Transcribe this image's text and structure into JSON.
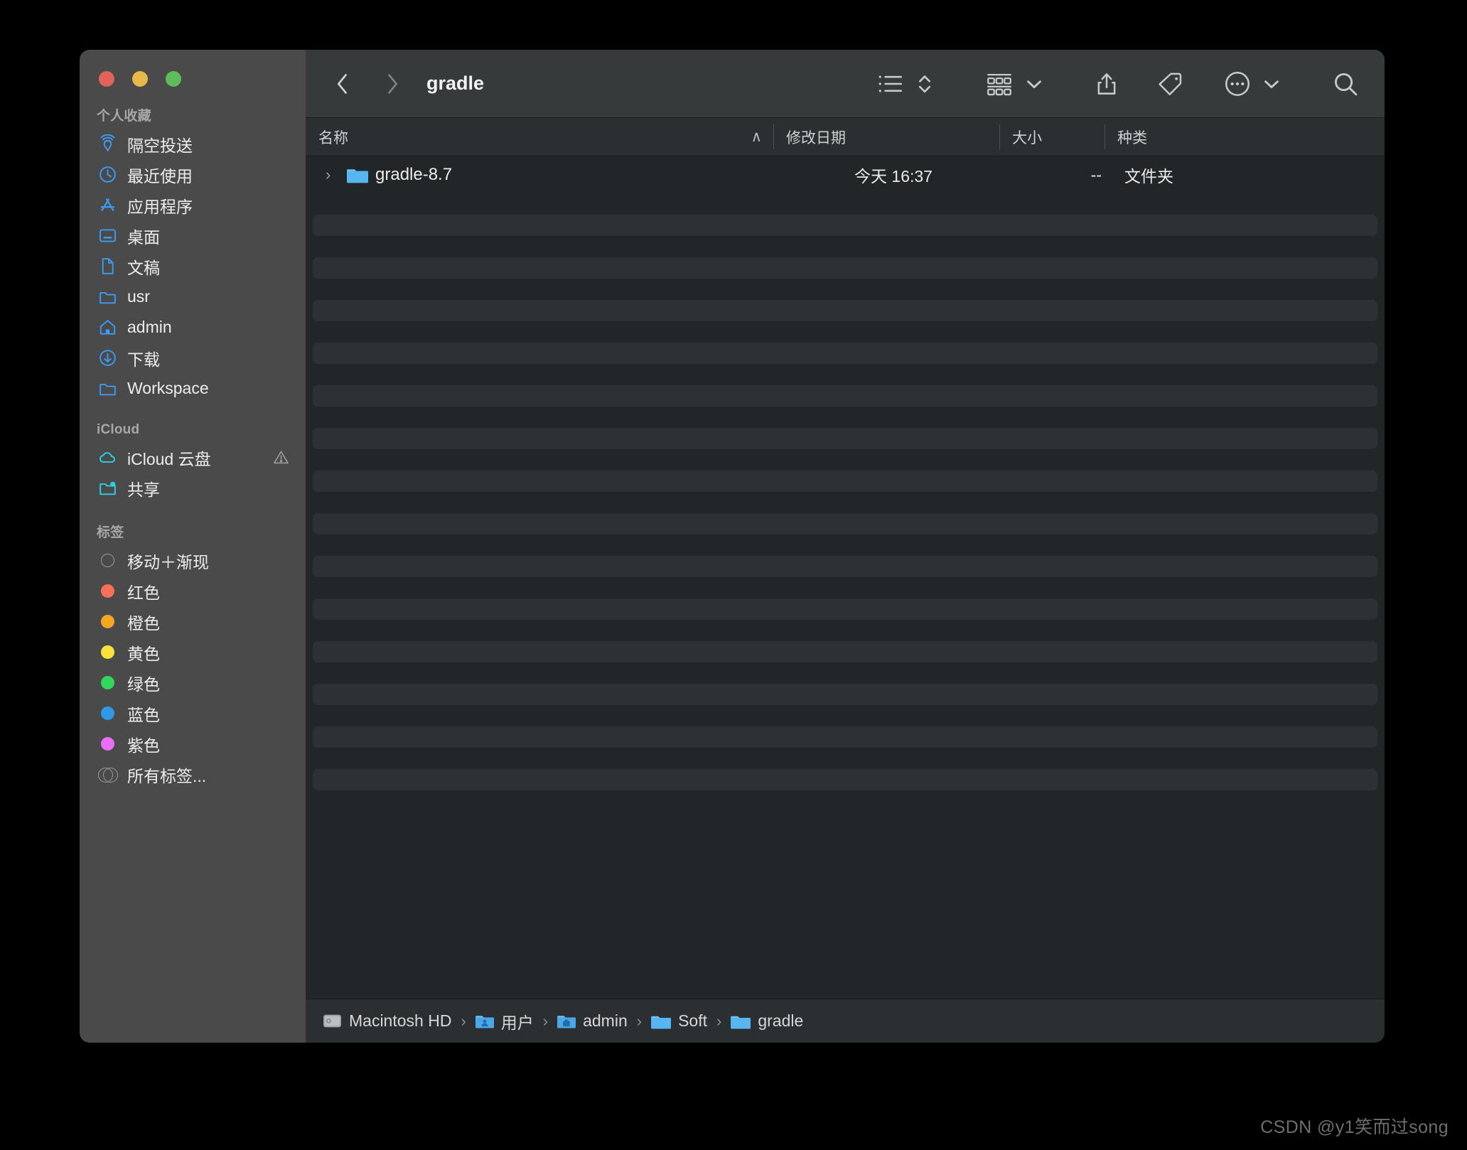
{
  "window": {
    "title": "gradle",
    "traffic_lights": [
      "close",
      "minimize",
      "maximize"
    ],
    "colors": {
      "close": "#e1645b",
      "minimize": "#e8b84b",
      "maximize": "#5ebd5a",
      "sidebar_bg": "#4a4a4a",
      "toolbar_bg": "#363a3b",
      "content_bg": "#222628",
      "stripe": "#2d3134",
      "accent_blue": "#3c9bf5",
      "accent_cyan": "#2ccfe6"
    }
  },
  "toolbar": {
    "back_label": "‹",
    "forward_label": "›",
    "buttons": [
      {
        "name": "view-list",
        "label": ""
      },
      {
        "name": "sort-stepper",
        "label": ""
      },
      {
        "name": "group-by",
        "label": ""
      },
      {
        "name": "group-by-chevron",
        "label": ""
      },
      {
        "name": "share",
        "label": ""
      },
      {
        "name": "tag",
        "label": ""
      },
      {
        "name": "more",
        "label": ""
      },
      {
        "name": "more-chevron",
        "label": ""
      },
      {
        "name": "search",
        "label": ""
      }
    ]
  },
  "sidebar": {
    "sections": [
      {
        "header": "个人收藏",
        "items": [
          {
            "label": "隔空投送",
            "icon": "airdrop-icon"
          },
          {
            "label": "最近使用",
            "icon": "recents-clock-icon"
          },
          {
            "label": "应用程序",
            "icon": "applications-icon"
          },
          {
            "label": "桌面",
            "icon": "desktop-icon"
          },
          {
            "label": "文稿",
            "icon": "documents-icon"
          },
          {
            "label": "usr",
            "icon": "folder-icon"
          },
          {
            "label": "admin",
            "icon": "home-icon"
          },
          {
            "label": "下载",
            "icon": "downloads-icon"
          },
          {
            "label": "Workspace",
            "icon": "folder-icon"
          }
        ]
      },
      {
        "header": "iCloud",
        "items": [
          {
            "label": "iCloud 云盘",
            "icon": "icloud-icon",
            "trailing_icon": "warning-icon"
          },
          {
            "label": "共享",
            "icon": "shared-folder-icon"
          }
        ]
      },
      {
        "header": "标签",
        "items": [
          {
            "label": "移动＋渐现",
            "icon": "tag-dot-outline",
            "color": "transparent"
          },
          {
            "label": "红色",
            "icon": "tag-dot",
            "color": "#fa6e5a"
          },
          {
            "label": "橙色",
            "icon": "tag-dot",
            "color": "#f5a623"
          },
          {
            "label": "黄色",
            "icon": "tag-dot",
            "color": "#fce23d"
          },
          {
            "label": "绿色",
            "icon": "tag-dot",
            "color": "#30d85c"
          },
          {
            "label": "蓝色",
            "icon": "tag-dot",
            "color": "#2f9ae8"
          },
          {
            "label": "紫色",
            "icon": "tag-dot",
            "color": "#ea6df5"
          },
          {
            "label": "所有标签...",
            "icon": "all-tags-icon",
            "color": "transparent"
          }
        ]
      }
    ]
  },
  "file_list": {
    "columns": [
      {
        "key": "name",
        "label": "名称",
        "sort_indicator": "∧"
      },
      {
        "key": "date",
        "label": "修改日期"
      },
      {
        "key": "size",
        "label": "大小"
      },
      {
        "key": "kind",
        "label": "种类"
      }
    ],
    "rows": [
      {
        "disclosure": "›",
        "icon": "folder-icon",
        "name": "gradle-8.7",
        "date": "今天 16:37",
        "size": "--",
        "kind": "文件夹"
      }
    ],
    "empty_stripe_count": 14
  },
  "path_bar": {
    "separator": "›",
    "segments": [
      {
        "label": "Macintosh HD",
        "icon": "hard-disk-icon"
      },
      {
        "label": "用户",
        "icon": "users-folder-icon"
      },
      {
        "label": "admin",
        "icon": "home-folder-icon"
      },
      {
        "label": "Soft",
        "icon": "folder-icon"
      },
      {
        "label": "gradle",
        "icon": "folder-icon"
      }
    ]
  },
  "watermark": {
    "text": "CSDN @y1笑而过song"
  }
}
